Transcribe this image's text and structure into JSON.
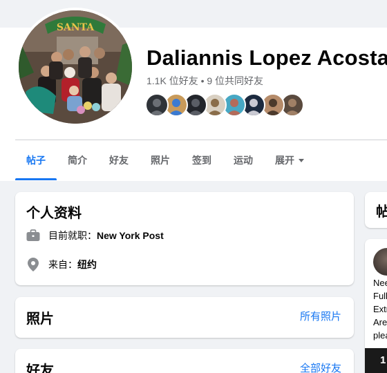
{
  "profile": {
    "name": "Daliannis Lopez Acosta",
    "friend_count": "1.1K 位好友 • 9 位共同好友",
    "avatar_sign_text": "SANTA"
  },
  "friend_avatars": [
    {
      "color": "#2f3338",
      "accent": "#6b6f75"
    },
    {
      "color": "#c89a5a",
      "accent": "#3a7ad1"
    },
    {
      "color": "#23262c",
      "accent": "#5a5e66"
    },
    {
      "color": "#d9d0c2",
      "accent": "#8a6d4a"
    },
    {
      "color": "#47a8c4",
      "accent": "#b46b5a"
    },
    {
      "color": "#1c2a3f",
      "accent": "#c9c9d2"
    },
    {
      "color": "#b58b6a",
      "accent": "#4c3a2c"
    },
    {
      "color": "#5a4a3e",
      "accent": "#a08066"
    }
  ],
  "tabs": [
    {
      "label": "帖子",
      "active": true
    },
    {
      "label": "简介",
      "active": false
    },
    {
      "label": "好友",
      "active": false
    },
    {
      "label": "照片",
      "active": false
    },
    {
      "label": "签到",
      "active": false
    },
    {
      "label": "运动",
      "active": false
    },
    {
      "label": "展开",
      "active": false
    }
  ],
  "intro": {
    "title": "个人资料",
    "work_prefix": "目前就职：",
    "work_value": "New York Post",
    "from_prefix": "来自：",
    "from_value": "纽约"
  },
  "photos": {
    "title": "照片",
    "link": "所有照片"
  },
  "friends": {
    "title": "好友",
    "link": "全部好友"
  },
  "right_column": {
    "posts_title_partial": "帖",
    "post_lines": [
      "Nee",
      "Full",
      "Extr",
      "Are",
      "plea"
    ],
    "media_partial": "1"
  },
  "colors": {
    "accent": "#1877f2",
    "secondary_text": "#65676b",
    "page_bg": "#f0f2f5"
  }
}
